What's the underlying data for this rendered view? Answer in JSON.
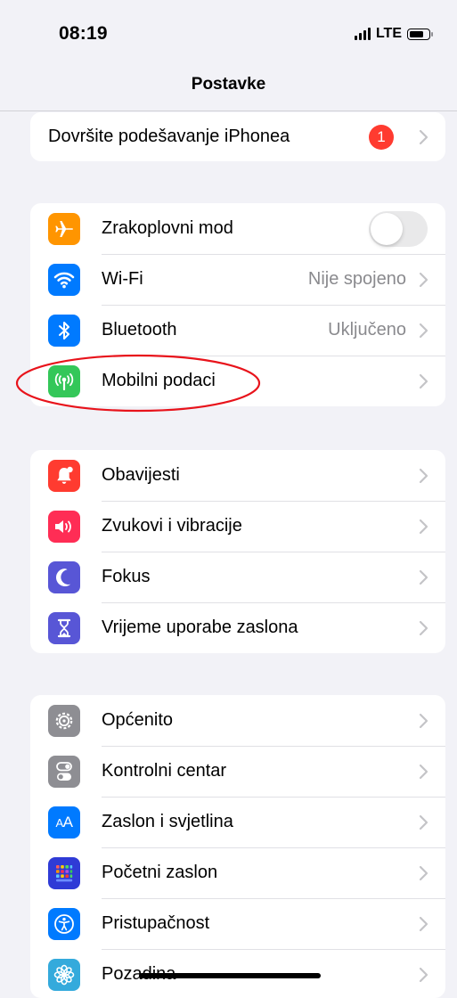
{
  "status": {
    "time": "08:19",
    "network": "LTE"
  },
  "nav": {
    "title": "Postavke"
  },
  "setup": {
    "label": "Dovršite podešavanje iPhonea",
    "badge": "1"
  },
  "connectivity": [
    {
      "label": "Zrakoplovni mod",
      "icon": "airplane-icon",
      "color": "#ff9500",
      "toggle_on": false
    },
    {
      "label": "Wi-Fi",
      "detail": "Nije spojeno",
      "icon": "wifi-icon",
      "color": "#007aff"
    },
    {
      "label": "Bluetooth",
      "detail": "Uključeno",
      "icon": "bluetooth-icon",
      "color": "#007aff"
    },
    {
      "label": "Mobilni podaci",
      "icon": "antenna-icon",
      "color": "#34c759",
      "highlighted": true
    }
  ],
  "notifications": [
    {
      "label": "Obavijesti",
      "icon": "bell-icon",
      "color": "#ff3b30"
    },
    {
      "label": "Zvukovi i vibracije",
      "icon": "speaker-icon",
      "color": "#ff2d55"
    },
    {
      "label": "Fokus",
      "icon": "moon-icon",
      "color": "#5856d6"
    },
    {
      "label": "Vrijeme uporabe zaslona",
      "icon": "hourglass-icon",
      "color": "#5856d6"
    }
  ],
  "general": [
    {
      "label": "Općenito",
      "icon": "gear-icon",
      "color": "#8e8e93"
    },
    {
      "label": "Kontrolni centar",
      "icon": "switches-icon",
      "color": "#8e8e93"
    },
    {
      "label": "Zaslon i svjetlina",
      "icon": "text-size-icon",
      "color": "#007aff"
    },
    {
      "label": "Početni zaslon",
      "icon": "home-grid-icon",
      "color": "#2f3bd6"
    },
    {
      "label": "Pristupačnost",
      "icon": "accessibility-icon",
      "color": "#007aff"
    },
    {
      "label": "Pozadina",
      "icon": "flower-icon",
      "color": "#34aadc"
    }
  ],
  "annotation_color": "#e8131b"
}
